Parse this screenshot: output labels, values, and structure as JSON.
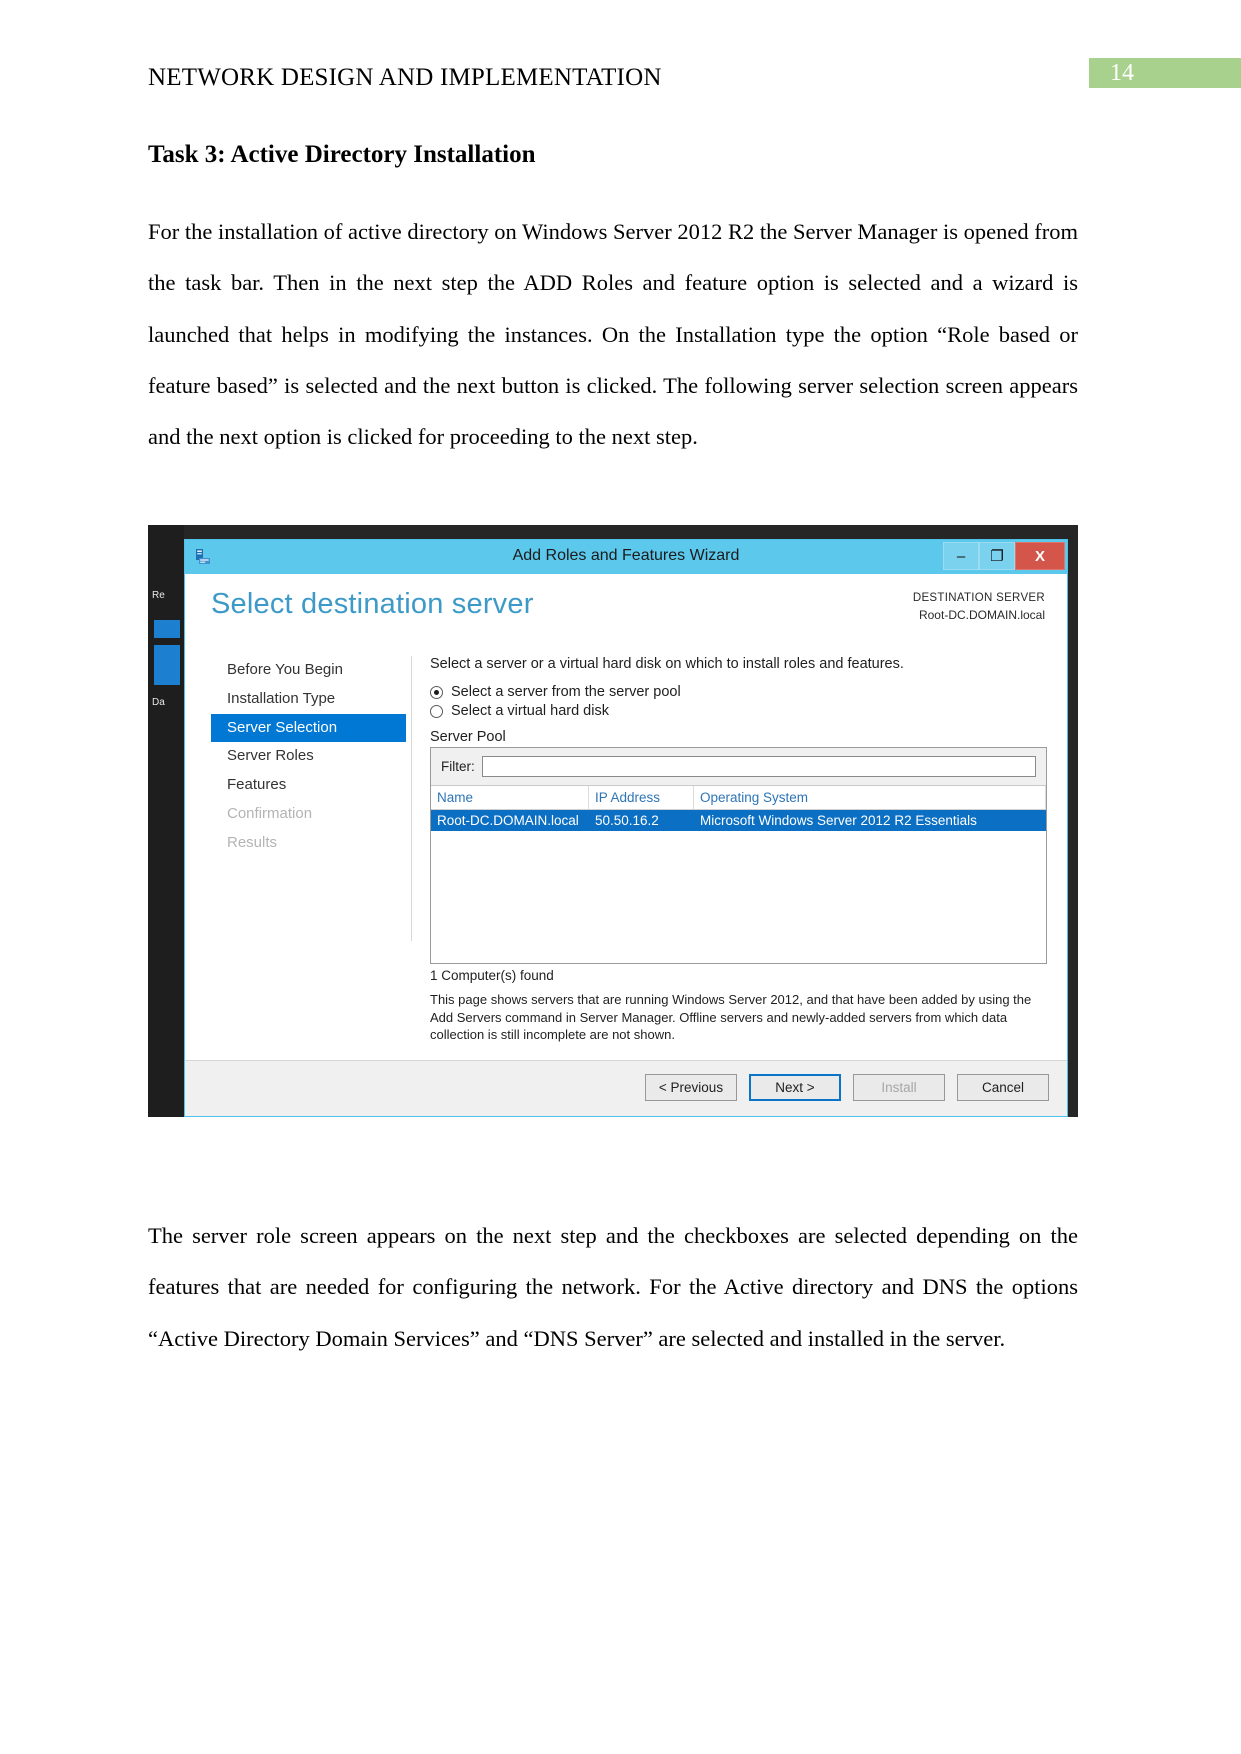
{
  "page": {
    "header_title": "NETWORK DESIGN AND IMPLEMENTATION",
    "page_number": "14",
    "badge_color": "#a9d18e"
  },
  "document": {
    "task_heading": "Task 3: Active Directory Installation",
    "paragraph_1": "For the installation of active directory on Windows Server 2012 R2 the Server Manager is opened from the task bar. Then in the next step the ADD Roles and feature option is selected and a wizard is launched that helps in modifying the instances. On the Installation type the option “Role based or feature based” is selected and the next button is clicked. The following server selection screen appears and the next option is clicked for proceeding to the next step.",
    "paragraph_2": "The server role screen appears on the next step and the checkboxes are selected depending on the features that are needed for configuring the network. For the Active directory and DNS the options “Active Directory Domain Services” and “DNS Server” are selected and installed in the server."
  },
  "screenshot": {
    "backdrop": {
      "label_1": "Re",
      "label_2": "Da"
    },
    "window": {
      "title": "Add Roles and Features Wizard",
      "icon": "server-wizard-icon",
      "controls": {
        "minimize": "–",
        "maximize": "❐",
        "close": "X"
      },
      "accent_color": "#5bc8ec"
    },
    "hero": {
      "title": "Select destination server",
      "destination_label": "DESTINATION SERVER",
      "destination_value": "Root-DC.DOMAIN.local"
    },
    "nav": {
      "items": [
        {
          "label": "Before You Begin",
          "state": "normal"
        },
        {
          "label": "Installation Type",
          "state": "normal"
        },
        {
          "label": "Server Selection",
          "state": "active"
        },
        {
          "label": "Server Roles",
          "state": "normal"
        },
        {
          "label": "Features",
          "state": "normal"
        },
        {
          "label": "Confirmation",
          "state": "dim"
        },
        {
          "label": "Results",
          "state": "dim"
        }
      ]
    },
    "pane": {
      "intro": "Select a server or a virtual hard disk on which to install roles and features.",
      "radio_pool": "Select a server from the server pool",
      "radio_vhd": "Select a virtual hard disk",
      "pool_label": "Server Pool",
      "filter_label": "Filter:",
      "filter_value": "",
      "filter_placeholder": "",
      "columns": [
        "Name",
        "IP Address",
        "Operating System"
      ],
      "rows": [
        {
          "name": "Root-DC.DOMAIN.local",
          "ip": "50.50.16.2",
          "os": "Microsoft Windows Server 2012 R2 Essentials",
          "selected": true
        }
      ],
      "found_text": "1 Computer(s) found",
      "note": "This page shows servers that are running Windows Server 2012, and that have been added by using the Add Servers command in Server Manager. Offline servers and newly-added servers from which data collection is still incomplete are not shown."
    },
    "footer": {
      "previous": "< Previous",
      "next": "Next >",
      "install": "Install",
      "cancel": "Cancel"
    }
  }
}
